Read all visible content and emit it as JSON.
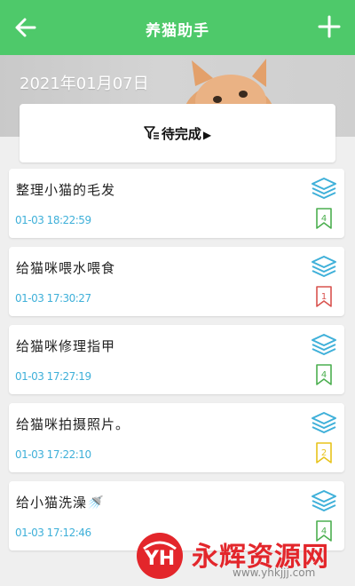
{
  "header": {
    "title": "养猫助手",
    "back_icon": "back-arrow-icon",
    "add_icon": "plus-icon",
    "color": "#4ec96a"
  },
  "banner": {
    "date": "2021年01月07日",
    "image": "orange-cat-photo"
  },
  "filter": {
    "label": "待完成",
    "icon": "filter-list-icon",
    "arrow": "▶"
  },
  "tasks": [
    {
      "title": "整理小猫的毛发",
      "time": "01-03 18:22:59",
      "priority": "4",
      "flag_color": "#4caf50"
    },
    {
      "title": "给猫咪喂水喂食",
      "time": "01-03 17:30:27",
      "priority": "1",
      "flag_color": "#d9534f"
    },
    {
      "title": "给猫咪修理指甲",
      "time": "01-03 17:27:19",
      "priority": "4",
      "flag_color": "#4caf50"
    },
    {
      "title": "给猫咪拍摄照片。",
      "time": "01-03 17:22:10",
      "priority": "2",
      "flag_color": "#e8c31c"
    },
    {
      "title": "给小猫洗澡🚿",
      "time": "01-03 17:12:46",
      "priority": "4",
      "flag_color": "#4caf50"
    }
  ],
  "watermark": {
    "logo_text": "YH",
    "name": "永辉资源网",
    "url": "www.yhkjjj.com"
  },
  "colors": {
    "time": "#3fb0d9",
    "layers_icon": "#3fb0d9"
  }
}
